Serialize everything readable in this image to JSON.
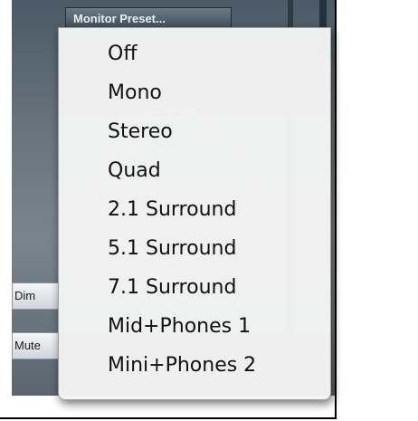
{
  "toolbar": {
    "monitor_preset_label": "Monitor Preset..."
  },
  "side_controls": {
    "dim_label": "Dim",
    "mute_label": "Mute"
  },
  "menu": {
    "items": [
      {
        "label": "Off"
      },
      {
        "label": "Mono"
      },
      {
        "label": "Stereo"
      },
      {
        "label": "Quad"
      },
      {
        "label": "2.1 Surround"
      },
      {
        "label": "5.1 Surround"
      },
      {
        "label": "7.1 Surround"
      },
      {
        "label": "Mid+Phones 1"
      },
      {
        "label": "Mini+Phones 2"
      }
    ]
  }
}
